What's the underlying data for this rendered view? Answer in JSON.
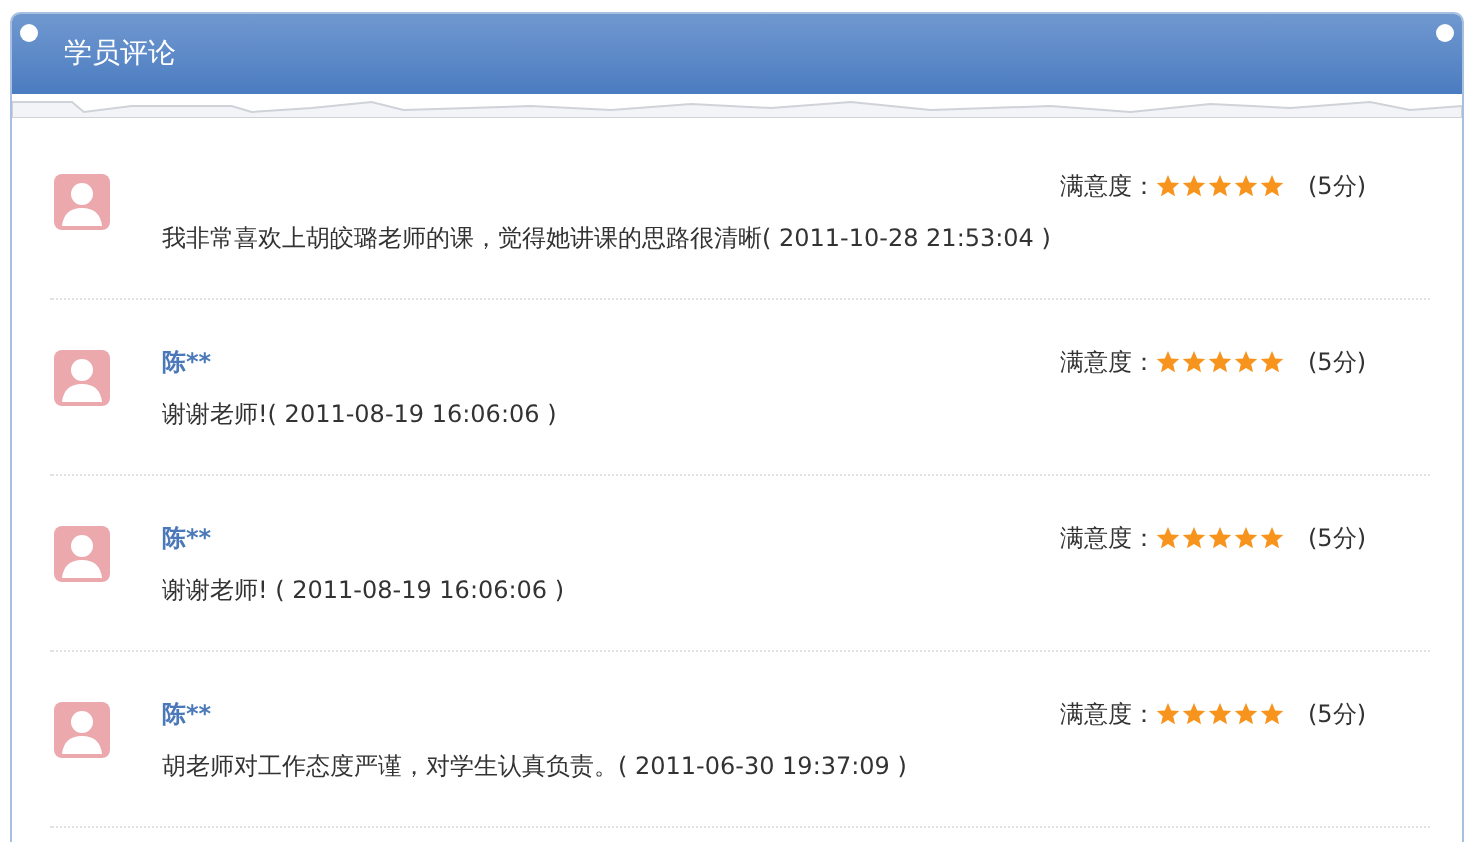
{
  "panel": {
    "title": "学员评论"
  },
  "reviews": [
    {
      "comment": "我非常喜欢上胡皎璐老师的课，觉得她讲课的思路很清晰( 2011-10-28 21:53:04 )",
      "rating_label": "满意度：",
      "stars": 5,
      "score": "(5分)"
    },
    {
      "name": "陈**",
      "comment": "谢谢老师!( 2011-08-19 16:06:06 )",
      "rating_label": "满意度：",
      "stars": 5,
      "score": "(5分)"
    },
    {
      "name": "陈**",
      "comment": "谢谢老师! ( 2011-08-19 16:06:06 )",
      "rating_label": "满意度：",
      "stars": 5,
      "score": "(5分)"
    },
    {
      "name": "陈**",
      "comment": "胡老师对工作态度严谨，对学生认真负责。( 2011-06-30 19:37:09 )",
      "rating_label": "满意度：",
      "stars": 5,
      "score": "(5分)"
    }
  ]
}
